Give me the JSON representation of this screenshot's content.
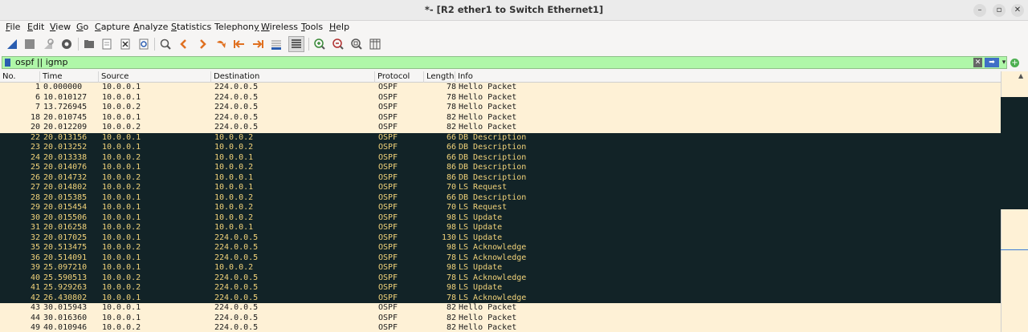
{
  "window": {
    "title": "*- [R2 ether1 to Switch Ethernet1]"
  },
  "menu": [
    {
      "label": "File",
      "ul": "F",
      "rest": "ile"
    },
    {
      "label": "Edit",
      "ul": "E",
      "rest": "dit"
    },
    {
      "label": "View",
      "ul": "V",
      "rest": "iew"
    },
    {
      "label": "Go",
      "ul": "G",
      "rest": "o"
    },
    {
      "label": "Capture",
      "ul": "C",
      "rest": "apture"
    },
    {
      "label": "Analyze",
      "ul": "A",
      "rest": "nalyze"
    },
    {
      "label": "Statistics",
      "ul": "S",
      "rest": "tatistics"
    },
    {
      "label": "Telephony",
      "ul": "y",
      "rest": "Telephon"
    },
    {
      "label": "Wireless",
      "ul": "W",
      "rest": "ireless"
    },
    {
      "label": "Tools",
      "ul": "T",
      "rest": "ools"
    },
    {
      "label": "Help",
      "ul": "H",
      "rest": "elp"
    }
  ],
  "filter": {
    "value": "ospf || igmp"
  },
  "columns": [
    "No.",
    "Time",
    "Source",
    "Destination",
    "Protocol",
    "Length",
    "Info"
  ],
  "packets": [
    {
      "no": "1",
      "time": "0.000000",
      "src": "10.0.0.1",
      "dst": "224.0.0.5",
      "proto": "OSPF",
      "len": "78",
      "info": "Hello Packet",
      "style": "hello"
    },
    {
      "no": "6",
      "time": "10.010127",
      "src": "10.0.0.1",
      "dst": "224.0.0.5",
      "proto": "OSPF",
      "len": "78",
      "info": "Hello Packet",
      "style": "hello"
    },
    {
      "no": "7",
      "time": "13.726945",
      "src": "10.0.0.2",
      "dst": "224.0.0.5",
      "proto": "OSPF",
      "len": "78",
      "info": "Hello Packet",
      "style": "hello"
    },
    {
      "no": "18",
      "time": "20.010745",
      "src": "10.0.0.1",
      "dst": "224.0.0.5",
      "proto": "OSPF",
      "len": "82",
      "info": "Hello Packet",
      "style": "hello"
    },
    {
      "no": "20",
      "time": "20.012209",
      "src": "10.0.0.2",
      "dst": "224.0.0.5",
      "proto": "OSPF",
      "len": "82",
      "info": "Hello Packet",
      "style": "hello"
    },
    {
      "no": "22",
      "time": "20.013156",
      "src": "10.0.0.1",
      "dst": "10.0.0.2",
      "proto": "OSPF",
      "len": "66",
      "info": "DB Description",
      "style": "dark"
    },
    {
      "no": "23",
      "time": "20.013252",
      "src": "10.0.0.1",
      "dst": "10.0.0.2",
      "proto": "OSPF",
      "len": "66",
      "info": "DB Description",
      "style": "dark"
    },
    {
      "no": "24",
      "time": "20.013338",
      "src": "10.0.0.2",
      "dst": "10.0.0.1",
      "proto": "OSPF",
      "len": "66",
      "info": "DB Description",
      "style": "dark"
    },
    {
      "no": "25",
      "time": "20.014076",
      "src": "10.0.0.1",
      "dst": "10.0.0.2",
      "proto": "OSPF",
      "len": "86",
      "info": "DB Description",
      "style": "dark"
    },
    {
      "no": "26",
      "time": "20.014732",
      "src": "10.0.0.2",
      "dst": "10.0.0.1",
      "proto": "OSPF",
      "len": "86",
      "info": "DB Description",
      "style": "dark"
    },
    {
      "no": "27",
      "time": "20.014802",
      "src": "10.0.0.2",
      "dst": "10.0.0.1",
      "proto": "OSPF",
      "len": "70",
      "info": "LS Request",
      "style": "dark"
    },
    {
      "no": "28",
      "time": "20.015385",
      "src": "10.0.0.1",
      "dst": "10.0.0.2",
      "proto": "OSPF",
      "len": "66",
      "info": "DB Description",
      "style": "dark"
    },
    {
      "no": "29",
      "time": "20.015454",
      "src": "10.0.0.1",
      "dst": "10.0.0.2",
      "proto": "OSPF",
      "len": "70",
      "info": "LS Request",
      "style": "dark"
    },
    {
      "no": "30",
      "time": "20.015506",
      "src": "10.0.0.1",
      "dst": "10.0.0.2",
      "proto": "OSPF",
      "len": "98",
      "info": "LS Update",
      "style": "dark"
    },
    {
      "no": "31",
      "time": "20.016258",
      "src": "10.0.0.2",
      "dst": "10.0.0.1",
      "proto": "OSPF",
      "len": "98",
      "info": "LS Update",
      "style": "dark"
    },
    {
      "no": "32",
      "time": "20.017025",
      "src": "10.0.0.1",
      "dst": "224.0.0.5",
      "proto": "OSPF",
      "len": "130",
      "info": "LS Update",
      "style": "dark"
    },
    {
      "no": "35",
      "time": "20.513475",
      "src": "10.0.0.2",
      "dst": "224.0.0.5",
      "proto": "OSPF",
      "len": "98",
      "info": "LS Acknowledge",
      "style": "dark"
    },
    {
      "no": "36",
      "time": "20.514091",
      "src": "10.0.0.1",
      "dst": "224.0.0.5",
      "proto": "OSPF",
      "len": "78",
      "info": "LS Acknowledge",
      "style": "dark"
    },
    {
      "no": "39",
      "time": "25.097210",
      "src": "10.0.0.1",
      "dst": "10.0.0.2",
      "proto": "OSPF",
      "len": "98",
      "info": "LS Update",
      "style": "dark"
    },
    {
      "no": "40",
      "time": "25.590513",
      "src": "10.0.0.2",
      "dst": "224.0.0.5",
      "proto": "OSPF",
      "len": "78",
      "info": "LS Acknowledge",
      "style": "dark"
    },
    {
      "no": "41",
      "time": "25.929263",
      "src": "10.0.0.2",
      "dst": "224.0.0.5",
      "proto": "OSPF",
      "len": "98",
      "info": "LS Update",
      "style": "dark"
    },
    {
      "no": "42",
      "time": "26.430802",
      "src": "10.0.0.1",
      "dst": "224.0.0.5",
      "proto": "OSPF",
      "len": "78",
      "info": "LS Acknowledge",
      "style": "dark"
    },
    {
      "no": "43",
      "time": "30.015943",
      "src": "10.0.0.1",
      "dst": "224.0.0.5",
      "proto": "OSPF",
      "len": "82",
      "info": "Hello Packet",
      "style": "hello"
    },
    {
      "no": "44",
      "time": "30.016360",
      "src": "10.0.0.1",
      "dst": "224.0.0.5",
      "proto": "OSPF",
      "len": "82",
      "info": "Hello Packet",
      "style": "hello"
    },
    {
      "no": "49",
      "time": "40.010946",
      "src": "10.0.0.2",
      "dst": "224.0.0.5",
      "proto": "OSPF",
      "len": "82",
      "info": "Hello Packet",
      "style": "hello"
    }
  ],
  "colors": {
    "hello_bg": "#fef1d6",
    "dark_bg": "#122327",
    "dark_fg": "#f2d37a",
    "filter_ok": "#aff7a8"
  },
  "icons": [
    "shark-fin-start-icon",
    "stop-icon",
    "restart-icon",
    "options-gear-icon",
    "open-folder-icon",
    "save-file-icon",
    "close-file-icon",
    "reload-icon",
    "find-icon",
    "back-icon",
    "forward-icon",
    "goto-icon",
    "first-packet-icon",
    "last-packet-icon",
    "autoscroll-icon",
    "colorize-icon",
    "zoom-in-icon",
    "zoom-out-icon",
    "zoom-normal-icon",
    "resize-columns-icon"
  ]
}
